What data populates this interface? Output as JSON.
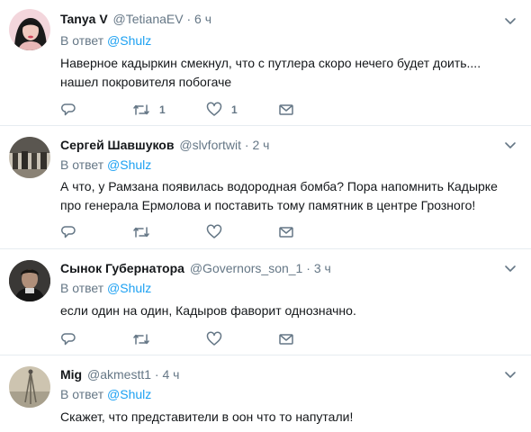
{
  "tweets": [
    {
      "fullname": "Tanya V",
      "username": "@TetianaEV",
      "dot": "·",
      "time": "6 ч",
      "reply_prefix": "В ответ",
      "reply_to": "@Shulz",
      "text": "Наверное кадыркин смекнул, что   с путлера скоро нечего будет доить.... нашел покровителя побогаче",
      "retweet_count": "1",
      "like_count": "1"
    },
    {
      "fullname": "Сергей Шавшуков",
      "username": "@slvfortwit",
      "dot": "·",
      "time": "2 ч",
      "reply_prefix": "В ответ",
      "reply_to": "@Shulz",
      "text": "А что, у Рамзана появилась водородная бомба? Пора напомнить Кадырке про генерала Ермолова и поставить тому памятник в центре Грозного!",
      "retweet_count": "",
      "like_count": ""
    },
    {
      "fullname": "Сынок Губернатора",
      "username": "@Governors_son_1",
      "dot": "·",
      "time": "3 ч",
      "reply_prefix": "В ответ",
      "reply_to": "@Shulz",
      "text": "если один на один, Кадыров фаворит однозначно.",
      "retweet_count": "",
      "like_count": ""
    },
    {
      "fullname": "Mig",
      "username": "@akmestt1",
      "dot": "·",
      "time": "4 ч",
      "reply_prefix": "В ответ",
      "reply_to": "@Shulz",
      "text": "Скажет, что представители в оон что то напутали!",
      "retweet_count": "",
      "like_count": ""
    }
  ],
  "icons": {
    "reply": "reply-icon",
    "retweet": "retweet-icon",
    "like": "heart-icon",
    "message": "envelope-icon",
    "menu": "chevron-down-icon"
  },
  "colors": {
    "link": "#1da1f2",
    "muted": "#657786",
    "text": "#14171a",
    "divider": "#e6ecf0"
  }
}
